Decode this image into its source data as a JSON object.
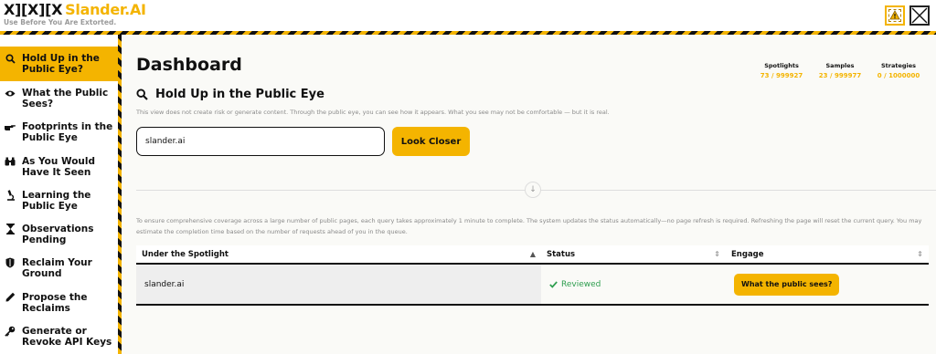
{
  "header": {
    "logo_mark": "X][X][X",
    "logo_brand": "Slander.AI",
    "tagline": "Use Before You Are Extorted."
  },
  "sidebar": {
    "items": [
      {
        "label": "Hold Up in the Public Eye?",
        "icon": "search-icon",
        "active": true
      },
      {
        "label": "What the Public Sees?",
        "icon": "eye-icon"
      },
      {
        "label": "Footprints in the Public Eye",
        "icon": "hand-pointing-icon"
      },
      {
        "label": "As You Would Have It Seen",
        "icon": "binoculars-icon"
      },
      {
        "label": "Learning the Public Eye",
        "icon": "microscope-icon"
      },
      {
        "label": "Observations Pending",
        "icon": "hourglass-icon"
      },
      {
        "label": "Reclaim Your Ground",
        "icon": "shield-icon"
      },
      {
        "label": "Propose the Reclaims",
        "icon": "pencil-icon"
      },
      {
        "label": "Generate or Revoke API Keys",
        "icon": "key-icon"
      }
    ]
  },
  "main": {
    "title": "Dashboard",
    "stats": [
      {
        "label": "Spotlights",
        "value": "73 / 999927"
      },
      {
        "label": "Samples",
        "value": "23 / 999977"
      },
      {
        "label": "Strategies",
        "value": "0 / 1000000"
      }
    ],
    "section_title": "Hold Up in the Public Eye",
    "section_desc": "This view does not create risk or generate content. Through the public eye, you can see how it appears. What you see may not be comfortable — but it is real.",
    "query_value": "slander.ai",
    "look_button": "Look Closer",
    "info_text": "To ensure comprehensive coverage across a large number of public pages, each query takes approximately 1 minute to complete. The system updates the status automatically—no page refresh is required. Refreshing the page will reset the current query. You may estimate the completion time based on the number of requests ahead of you in the queue.",
    "table": {
      "headers": [
        "Under the Spotlight",
        "Status",
        "Engage"
      ],
      "rows": [
        {
          "target": "slander.ai",
          "status": "Reviewed",
          "action": "What the public sees?"
        }
      ]
    }
  },
  "colors": {
    "accent": "#f4b400",
    "status_ok": "#2e9e4f"
  }
}
